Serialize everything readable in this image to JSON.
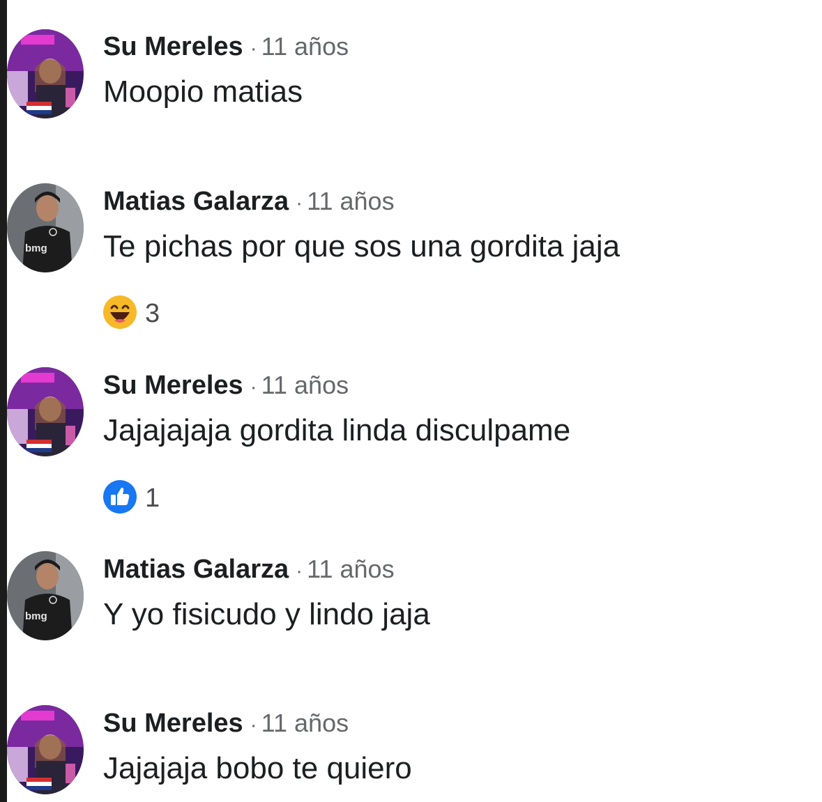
{
  "comments": [
    {
      "author": "Su Mereles",
      "separator": "·",
      "time": "11 años",
      "text": "Moopio matias",
      "avatar": "su-mereles-avatar"
    },
    {
      "author": "Matias Galarza",
      "separator": "·",
      "time": "11 años",
      "text": "Te pichas por que sos una gordita jaja",
      "avatar": "matias-galarza-avatar",
      "jersey_text": "bmg",
      "reaction": {
        "icon": "haha-reaction-icon",
        "count": "3"
      }
    },
    {
      "author": "Su Mereles",
      "separator": "·",
      "time": "11 años",
      "text": "Jajajajaja gordita linda disculpame",
      "avatar": "su-mereles-avatar",
      "reaction": {
        "icon": "like-reaction-icon",
        "count": "1"
      }
    },
    {
      "author": "Matias Galarza",
      "separator": "·",
      "time": "11 años",
      "text": "Y yo fisicudo y lindo jaja",
      "avatar": "matias-galarza-avatar",
      "jersey_text": "bmg"
    },
    {
      "author": "Su Mereles",
      "separator": "·",
      "time": "11 años",
      "text": "Jajajaja bobo te quiero",
      "avatar": "su-mereles-avatar"
    }
  ],
  "colors": {
    "author": "#1c1e21",
    "meta": "#65676b",
    "like_blue": "#1877f2",
    "haha_yellow": "#f7b928"
  }
}
